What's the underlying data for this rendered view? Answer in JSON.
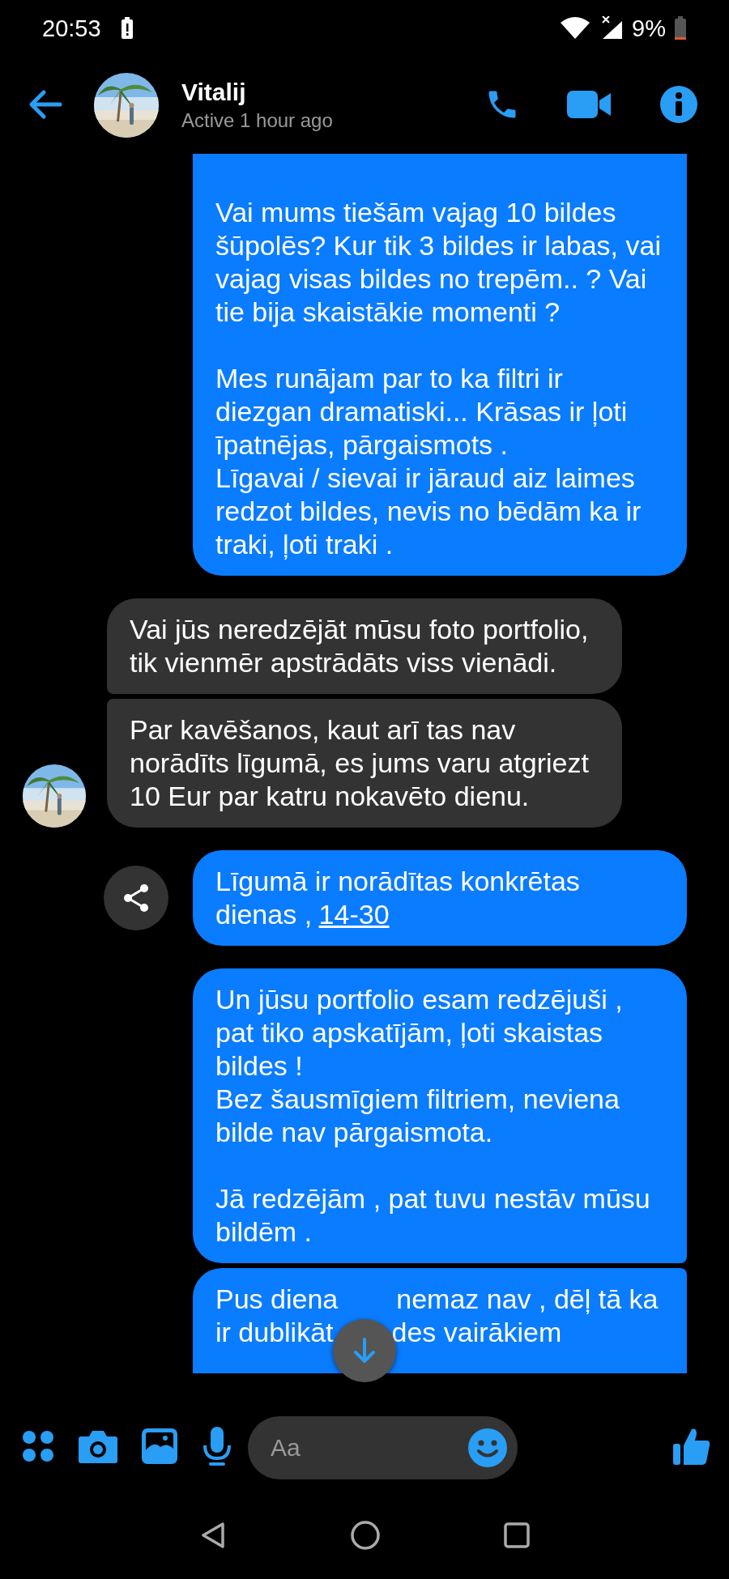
{
  "status_bar": {
    "time": "20:53",
    "battery": "9%"
  },
  "header": {
    "name": "Vitalij",
    "status": "Active 1 hour ago"
  },
  "messages": [
    {
      "kind": "sent",
      "share": false,
      "blocks": [
        [
          "Vai mums tiešām vajag 10 bildes šūpolēs? Kur tik 3 bildes ir labas, vai vajag visas bildes no trepēm.. ? Vai tie bija skaistākie momenti ?"
        ],
        [
          "Mes runājam par to ka filtri ir diezgan dramatiski... Krāsas ir ļoti īpatnējas, pārgaismots .",
          "Līgavai / sievai ir jāraud aiz laimes redzot bildes, nevis no bēdām ka ir traki, ļoti traki ."
        ]
      ]
    },
    {
      "kind": "received",
      "avatar": false,
      "blocks": [
        [
          "Vai jūs neredzējāt mūsu foto portfolio, tik vienmēr apstrādāts viss vienādi."
        ]
      ]
    },
    {
      "kind": "received",
      "avatar": true,
      "blocks": [
        [
          "Par kavēšanos, kaut arī tas nav norādīts līgumā, es jums varu atgriezt 10 Eur par katru nokavēto dienu."
        ]
      ]
    },
    {
      "kind": "sent",
      "share": true,
      "blocks": [
        [
          "Līgumā ir norādītas konkrētas dienas ,"
        ]
      ],
      "link": "14-30"
    },
    {
      "kind": "sent",
      "share": false,
      "blocks": [
        [
          "Un jūsu portfolio esam redzējuši , pat tiko apskatījām, ļoti skaistas bildes !",
          "Bez šausmīgiem filtriem, neviena bilde nav pārgaismota."
        ],
        [
          "Jā redzējām , pat tuvu nestāv mūsu bildēm ."
        ]
      ]
    },
    {
      "kind": "covered",
      "share": false,
      "lines": [
        [
          "Pus diena",
          "nemaz nav , dēļ tā ka"
        ],
        [
          "ir dublikāt",
          "des vairākiem"
        ]
      ]
    }
  ],
  "composer": {
    "placeholder": "Aa"
  }
}
